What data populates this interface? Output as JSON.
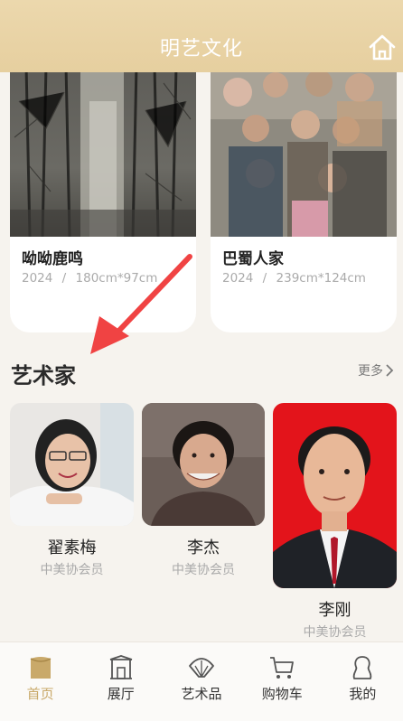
{
  "header": {
    "title": "明艺文化",
    "home_icon": "home-icon"
  },
  "works": [
    {
      "title": "呦呦鹿鸣",
      "year": "2024",
      "sep": "/",
      "size": "180cm*97cm"
    },
    {
      "title": "巴蜀人家",
      "year": "2024",
      "sep": "/",
      "size": "239cm*124cm"
    }
  ],
  "artists_section": {
    "title": "艺术家",
    "more_label": "更多"
  },
  "artists": [
    {
      "name": "翟素梅",
      "role": "中美协会员"
    },
    {
      "name": "李杰",
      "role": "中美协会员"
    },
    {
      "name": "李刚",
      "role": "中美协会员"
    }
  ],
  "tabs": [
    {
      "label": "首页",
      "icon": "home-tab-icon",
      "active": true
    },
    {
      "label": "展厅",
      "icon": "gallery-icon",
      "active": false
    },
    {
      "label": "艺术品",
      "icon": "fan-icon",
      "active": false
    },
    {
      "label": "购物车",
      "icon": "cart-icon",
      "active": false
    },
    {
      "label": "我的",
      "icon": "profile-icon",
      "active": false
    }
  ],
  "colors": {
    "accent": "#c9a96a",
    "header": "#e6cf9f",
    "annotation_arrow": "#f04343"
  }
}
